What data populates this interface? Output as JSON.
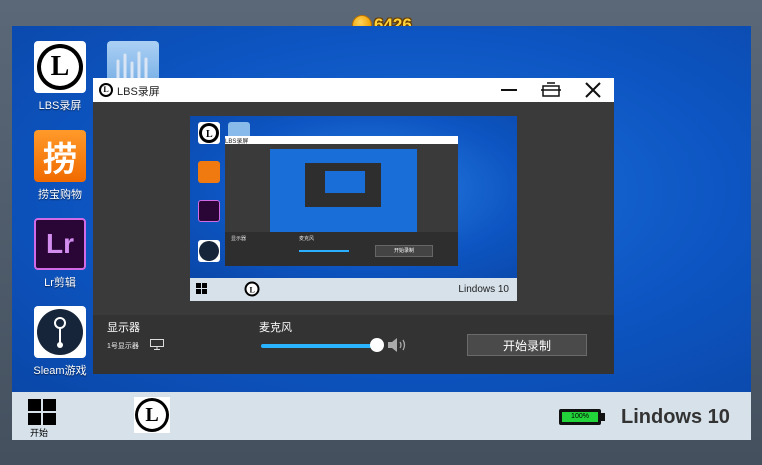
{
  "hud": {
    "coins": "6426"
  },
  "desktop": {
    "icons": [
      {
        "label": "LBS录屏",
        "glyph": "L"
      },
      {
        "label": "捞宝购物",
        "glyph": "捞"
      },
      {
        "label": "Lr剪辑",
        "glyph": "Lr"
      },
      {
        "label": "Sleam游戏",
        "glyph": ""
      }
    ]
  },
  "window": {
    "title": "LBS录屏",
    "controls": {
      "minimize": "—",
      "restore": "⧉",
      "close": "✕"
    },
    "preview": {
      "os_name": "Lindows 10",
      "mini_title": "LBS录屏",
      "mini_display": "显示器",
      "mini_mic": "麦克风",
      "mini_button": "开始录制"
    },
    "display_label": "显示器",
    "display_value": "1号显示器",
    "mic_label": "麦克风",
    "mic_volume": 0.92,
    "record_button": "开始录制"
  },
  "taskbar": {
    "start_label": "开始",
    "battery_percent": "100%",
    "battery_level": 1.0,
    "os_name": "Lindows 10"
  },
  "colors": {
    "desktop": "#0d55c2",
    "accent": "#2ab3ff",
    "battery": "#22d43a",
    "coin": "#ffd23a"
  }
}
